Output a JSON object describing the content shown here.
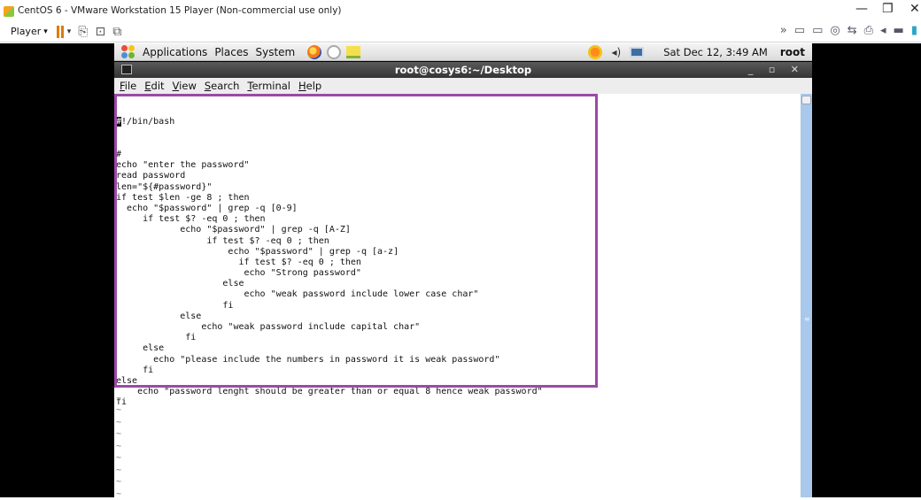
{
  "vm_window": {
    "title": "CentOS 6 - VMware Workstation 15 Player (Non-commercial use only)",
    "minimize": "—",
    "restore": "❐",
    "close": "✕"
  },
  "vm_toolbar": {
    "player_label": "Player",
    "player_caret": "▾",
    "pause_caret": "▾",
    "icons": [
      "send-ctrl-alt-del-icon",
      "fit-guest-icon",
      "unity-icon"
    ],
    "right_icons": [
      "chevron-right-icon",
      "removable-devices-icon",
      "network-adapter-icon",
      "cd-icon",
      "usb-icon",
      "printer-icon",
      "sound-icon",
      "hard-disk-icon",
      "message-icon"
    ]
  },
  "gnome_panel": {
    "menus": [
      "Applications",
      "Places",
      "System"
    ],
    "clock": "Sat Dec 12,  3:49 AM",
    "user": "root"
  },
  "terminal": {
    "title": "root@cosys6:~/Desktop",
    "controls": "_ ▫ ✕",
    "menu": [
      "File",
      "Edit",
      "View",
      "Search",
      "Terminal",
      "Help"
    ],
    "cursor_char": "#",
    "first_line_rest": "!/bin/bash",
    "lines": [
      "#",
      "echo \"enter the password\"",
      "read password",
      "len=\"${#password}\"",
      "if test $len -ge 8 ; then",
      "  echo \"$password\" | grep -q [0-9]",
      "     if test $? -eq 0 ; then",
      "            echo \"$password\" | grep -q [A-Z]",
      "                 if test $? -eq 0 ; then",
      "                     echo \"$password\" | grep -q [a-z]",
      "                       if test $? -eq 0 ; then",
      "                        echo \"Strong password\"",
      "                    else",
      "                        echo \"weak password include lower case char\"",
      "                    fi",
      "            else",
      "                echo \"weak password include capital char\"",
      "             fi",
      "     else",
      "       echo \"please include the numbers in password it is weak password\"",
      "     fi",
      "else",
      "    echo \"password lenght should be greater than or equal 8 hence weak password\"",
      "fi"
    ],
    "tilde": "~\n~\n~\n~\n~\n~\n~\n~\n~\n~"
  },
  "colors": {
    "highlight_border": "#9c49a9",
    "scrollbar": "#a8c8ec",
    "vm_background": "#000000"
  }
}
